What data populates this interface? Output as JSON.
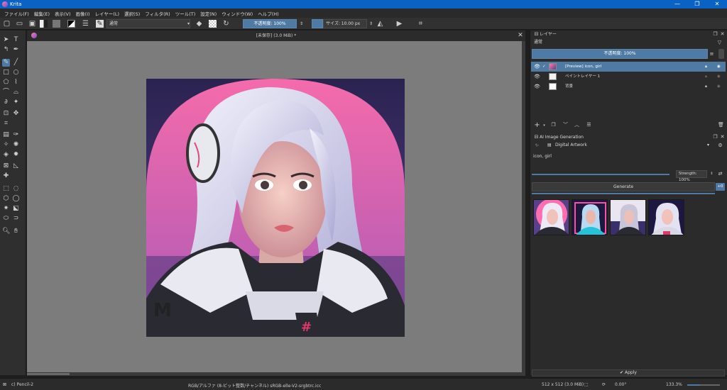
{
  "app": {
    "title": "Krita",
    "window_buttons": [
      "—",
      "❐",
      "✕"
    ]
  },
  "menu": [
    "ファイル(F)",
    "編集(E)",
    "表示(V)",
    "画像(I)",
    "レイヤー(L)",
    "選択(S)",
    "フィルタ(R)",
    "ツール(T)",
    "設定(N)",
    "ウィンドウ(W)",
    "ヘルプ(H)"
  ],
  "toolbar": {
    "blend_mode": "通常",
    "opacity": "不透明度: 100%",
    "size": "サイズ: 10.00 px"
  },
  "document": {
    "tab_title": "[未保存] (3.0 MiB) *"
  },
  "layers_panel": {
    "title": "レイヤー",
    "blend_mode": "通常",
    "opacity": "不透明度: 100%",
    "layers": [
      {
        "name": "[Preview] icon, girl",
        "selected": true
      },
      {
        "name": "ペイントレイヤー 1",
        "selected": false
      },
      {
        "name": "背景",
        "selected": false
      }
    ]
  },
  "ai_panel": {
    "title": "AI Image Generation",
    "style": "Digital Artwork",
    "prompt": "icon, girl",
    "strength": "Strength: 100%",
    "generate_label": "Generate",
    "plus_badge": "+0",
    "apply_label": "Apply"
  },
  "status": {
    "brush": "c) Pencil-2",
    "color_info": "RGB/アルファ (8-ビット整数/チャンネル)  sRGB-elle-V2-srgbtrc.icc",
    "dimensions": "512 x 512 (3.0 MiB)",
    "rotation": "0.00°",
    "zoom": "133.3%"
  },
  "colors": {
    "accent": "#4f7aa4",
    "titlebar": "#0a63c4",
    "canvas_bg": "#7c7c7c",
    "panel_bg": "#2b2b2b"
  }
}
